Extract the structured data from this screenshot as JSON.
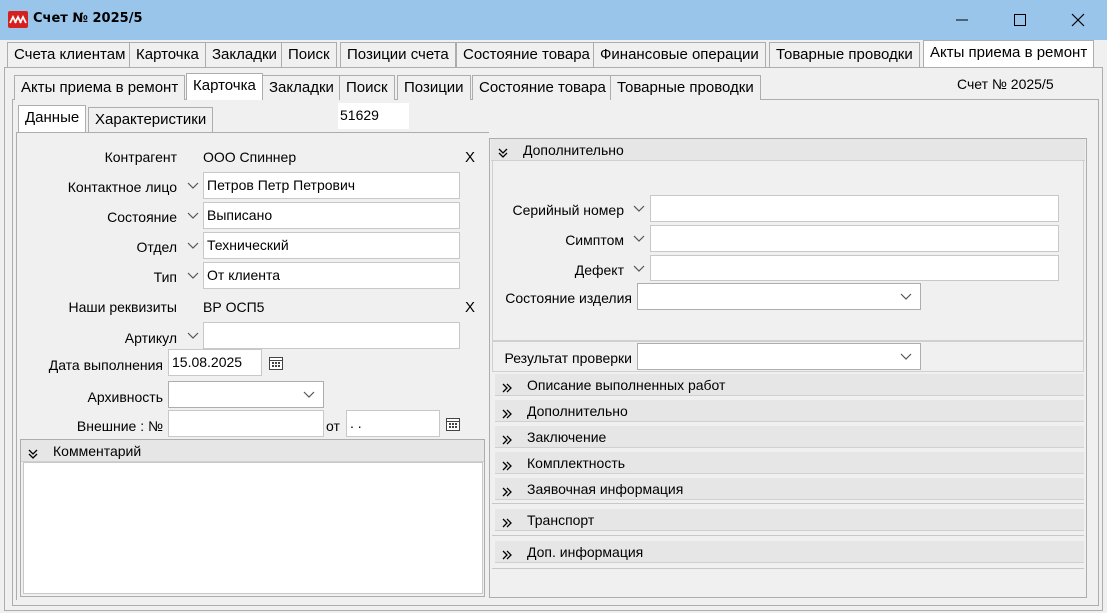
{
  "window": {
    "title": "Счет № 2025/5"
  },
  "tabs_top": [
    {
      "label": "Счета клиентам"
    },
    {
      "label": "Карточка"
    },
    {
      "label": "Закладки"
    },
    {
      "label": "Поиск"
    },
    {
      "label": "Позиции счета"
    },
    {
      "label": "Состояние товара"
    },
    {
      "label": "Финансовые операции"
    },
    {
      "label": "Товарные проводки"
    },
    {
      "label": "Акты приема в ремонт"
    }
  ],
  "tabs_second": [
    {
      "label": "Акты приема в ремонт"
    },
    {
      "label": "Карточка"
    },
    {
      "label": "Закладки"
    },
    {
      "label": "Поиск"
    },
    {
      "label": "Позиции"
    },
    {
      "label": "Состояние товара"
    },
    {
      "label": "Товарные проводки"
    }
  ],
  "doc_caption": "Счет № 2025/5",
  "tabs_third": [
    {
      "label": "Данные"
    },
    {
      "label": "Характеристики"
    }
  ],
  "record_id": "51629",
  "form": {
    "kontragent_label": "Контрагент",
    "kontragent_value": "ООО Спиннер",
    "contact_label": "Контактное лицо",
    "contact_value": "Петров Петр Петрович",
    "state_label": "Состояние",
    "state_value": "Выписано",
    "dept_label": "Отдел",
    "dept_value": "Технический",
    "type_label": "Тип",
    "type_value": "От клиента",
    "requisites_label": "Наши реквизиты",
    "requisites_value": "ВР ОСП5",
    "article_label": "Артикул",
    "article_value": "",
    "date_label": "Дата выполнения",
    "date_value": "15.08.2025",
    "archive_label": "Архивность",
    "archive_value": "",
    "external_label": "Внешние : №",
    "external_value": "",
    "from_label": "от",
    "from_value": " .  .",
    "clear_mark": "X"
  },
  "comment": {
    "header": "Комментарий",
    "text": ""
  },
  "right_panel": {
    "additional_header": "Дополнительно",
    "serial_label": "Серийный номер",
    "serial_value": "",
    "symptom_label": "Симптом",
    "symptom_value": "",
    "defect_label": "Дефект",
    "defect_value": "",
    "condition_label": "Состояние изделия",
    "condition_value": "",
    "check_result_label": "Результат проверки",
    "check_result_value": "",
    "sections": [
      {
        "label": "Описание выполненных работ"
      },
      {
        "label": "Дополнительно"
      },
      {
        "label": "Заключение"
      },
      {
        "label": "Комплектность"
      },
      {
        "label": "Заявочная информация"
      },
      {
        "label": "Транспорт"
      },
      {
        "label": "Доп. информация"
      }
    ]
  },
  "colors": {
    "titlebar": "#99c5ea",
    "logo": "#d6201f",
    "window_bg": "#f0f0f0"
  }
}
